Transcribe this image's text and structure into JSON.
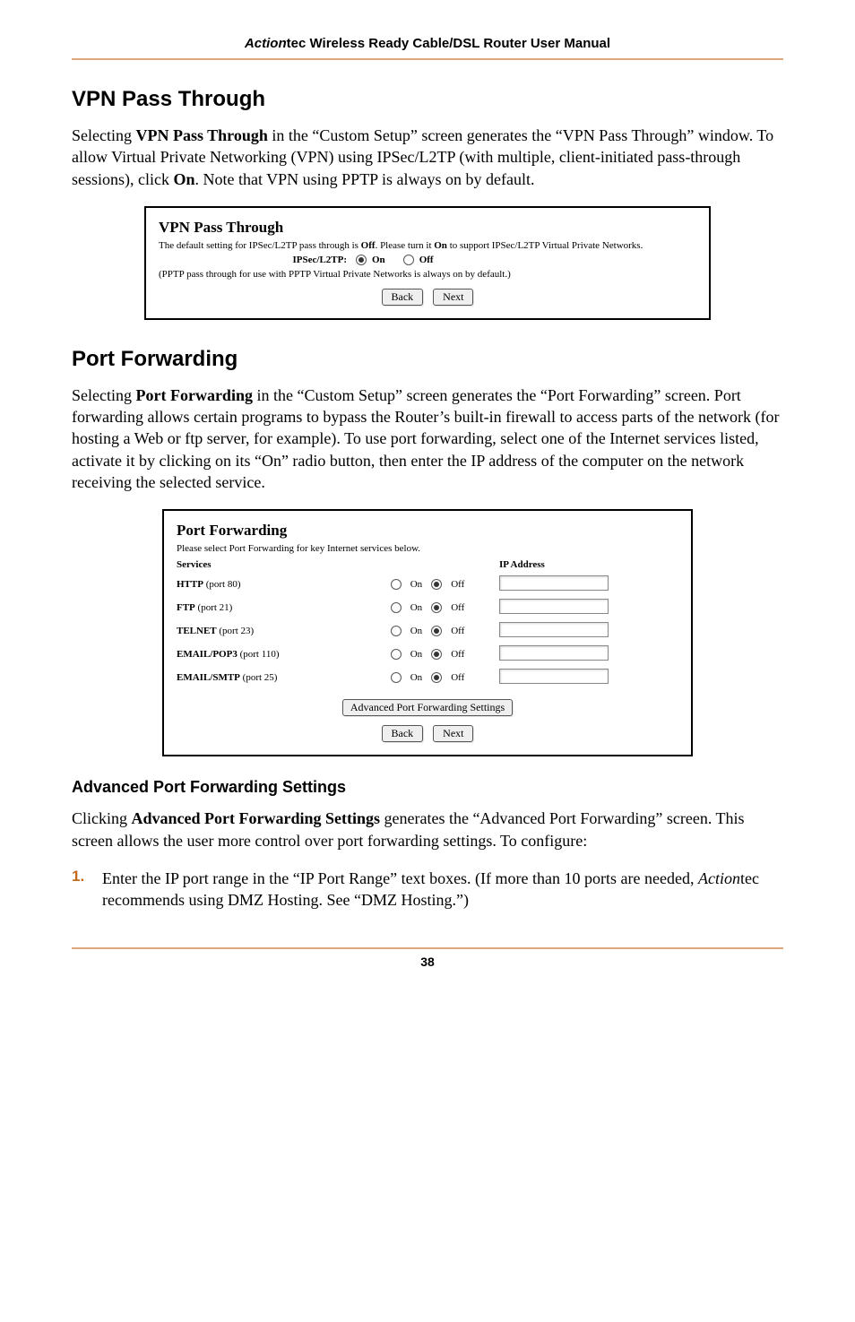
{
  "header": {
    "brand_italic": "Action",
    "brand_rest": "tec",
    "title_rest": " Wireless Ready Cable/DSL Router User Manual"
  },
  "section1": {
    "title": "VPN Pass Through",
    "para_parts": [
      "Selecting ",
      "VPN Pass Through",
      " in the “Custom Setup” screen generates the “VPN Pass Through” window. To allow Virtual Private Networking (VPN) using IPSec/L2TP (with multiple, client-initiated pass-through sessions), click ",
      "On",
      ". Note that VPN using PPTP is always on by default."
    ]
  },
  "fig1": {
    "title": "VPN Pass Through",
    "desc_a": "The default setting for IPSec/L2TP pass through is ",
    "desc_off": "Off",
    "desc_b": ". Please turn it ",
    "desc_on": "On",
    "desc_c": " to support IPSec/L2TP Virtual Private Networks.",
    "row_label": "IPSec/L2TP:",
    "on_label": "On",
    "off_label": "Off",
    "note": "(PPTP pass through for use with PPTP Virtual Private Networks is always on by default.)",
    "back": "Back",
    "next": "Next"
  },
  "section2": {
    "title": "Port Forwarding",
    "para_parts": [
      "Selecting ",
      "Port Forwarding",
      " in the “Custom Setup” screen generates the “Port Forwarding” screen. Port forwarding allows certain programs to bypass the Router’s built-in firewall to access parts of the network (for hosting a Web or ftp server, for example). To use port forwarding, select one of the Internet services listed, activate it by clicking on its “On” radio button, then enter the IP address of the computer on the network receiving the selected service."
    ]
  },
  "fig2": {
    "title": "Port Forwarding",
    "subtitle": "Please select Port Forwarding for key Internet services below.",
    "col_services": "Services",
    "col_ip": "IP Address",
    "on_label": "On",
    "off_label": "Off",
    "rows": [
      {
        "name": "HTTP",
        "port": "(port 80)"
      },
      {
        "name": "FTP",
        "port": "(port 21)"
      },
      {
        "name": "TELNET",
        "port": "(port 23)"
      },
      {
        "name": "EMAIL/POP3",
        "port": "(port 110)"
      },
      {
        "name": "EMAIL/SMTP",
        "port": "(port 25)"
      }
    ],
    "adv_btn": "Advanced Port Forwarding Settings",
    "back": "Back",
    "next": "Next"
  },
  "section3": {
    "title": "Advanced Port Forwarding Settings",
    "para_parts": [
      "Clicking ",
      "Advanced Port Forwarding Settings",
      " generates the “Advanced Port Forwarding” screen. This screen allows the user more control over port forwarding settings. To configure:"
    ]
  },
  "steps": {
    "num1": "1.",
    "step1_a": "Enter the IP port range in the “IP Port Range” text boxes. (If more than 10 ports are needed, ",
    "step1_italic": "Action",
    "step1_b": "tec recommends using DMZ Hosting. See “DMZ Hosting.”)"
  },
  "footer": {
    "page": "38"
  }
}
